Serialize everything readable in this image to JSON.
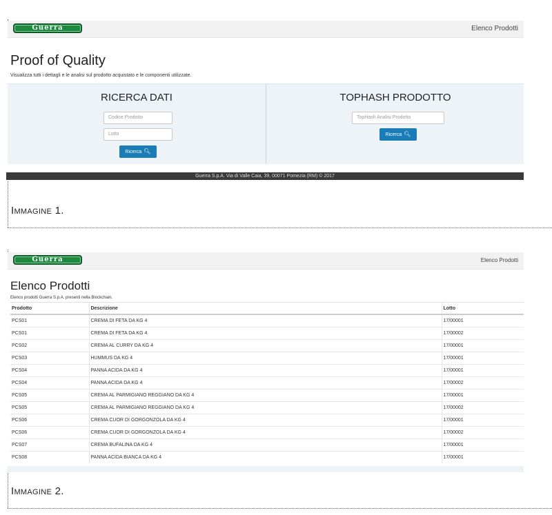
{
  "screen1": {
    "brand": "Guerra",
    "nav_link": "Elenco Prodotti",
    "title": "Proof of Quality",
    "subtitle": "Visualizza tutti i dettagli e le analisi sul prodotto acquistato e le componenti utilizzate.",
    "left": {
      "heading": "RICERCA DATI",
      "code_placeholder": "Codice Prodotto",
      "lot_placeholder": "Lotto",
      "search_label": "Ricerca"
    },
    "right": {
      "heading": "TOPHASH PRODOTTO",
      "hash_placeholder": "TopHash Analisi Prodotto",
      "search_label": "Ricerca"
    },
    "footer": "Guerra S.p.A. Via di Valle Caia, 39, 00071 Pomezia (RM) © 2017",
    "caption_first": "I",
    "caption_rest": "MMAGINE",
    "caption_num": "1."
  },
  "screen2": {
    "brand": "Guerra",
    "nav_link": "Elenco Prodotti",
    "title": "Elenco Prodotti",
    "subtitle": "Elenco prodotti Guerra S.p.A. presenti nella Blockchain.",
    "columns": [
      "Prodotto",
      "Descrizione",
      "Lotto"
    ],
    "rows": [
      [
        "PCS01",
        "CREMA DI FETA DA KG 4",
        "17/00001"
      ],
      [
        "PCS01",
        "CREMA DI FETA DA KG 4",
        "17/00002"
      ],
      [
        "PCS02",
        "CREMA AL CURRY DA KG 4",
        "17/00001"
      ],
      [
        "PCS03",
        "HUMMUS DA KG 4",
        "17/00001"
      ],
      [
        "PCS04",
        "PANNA ACIDA DA KG 4",
        "17/00001"
      ],
      [
        "PCS04",
        "PANNA ACIDA DA KG 4",
        "17/00002"
      ],
      [
        "PCS05",
        "CREMA AL PARMIGIANO REGGIANO DA KG 4",
        "17/00001"
      ],
      [
        "PCS05",
        "CREMA AL PARMIGIANO REGGIANO DA KG 4",
        "17/00002"
      ],
      [
        "PCS06",
        "CREMA CUOR DI GORGONZOLA DA KG 4",
        "17/00001"
      ],
      [
        "PCS06",
        "CREMA CUOR DI GORGONZOLA DA KG 4",
        "17/00002"
      ],
      [
        "PCS07",
        "CREMA BUFALINA DA KG 4",
        "17/00001"
      ],
      [
        "PCS08",
        "PANNA ACIDA BIANCA DA KG 4",
        "17/00001"
      ]
    ],
    "caption_first": "I",
    "caption_rest": "MMAGINE",
    "caption_num": "2."
  },
  "colors": {
    "brand_green": "#1d8a3f",
    "button_blue": "#1b7db8",
    "footer_dark": "#3a3a3a"
  },
  "icons": {
    "search": "magnifier-icon"
  }
}
